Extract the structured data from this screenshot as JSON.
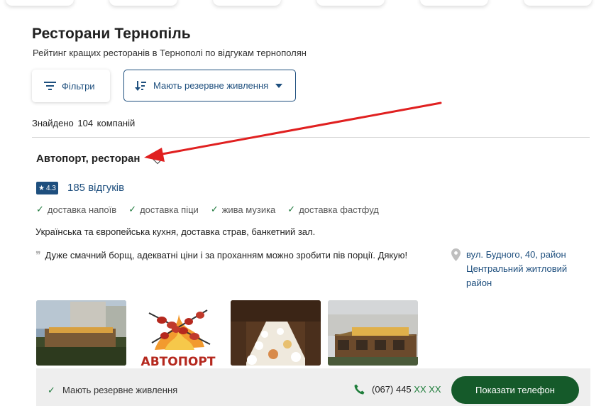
{
  "header": {
    "title": "Ресторани Тернопіль",
    "subtitle": "Рейтинг кращих ресторанів в Тернополі по відгукам тернополян"
  },
  "toolbar": {
    "filters_label": "Фільтри",
    "sort_value": "Мають резервне живлення"
  },
  "results": {
    "found_text": "Знайдено  104  компаній"
  },
  "company": {
    "name": "Автопорт, ресторан",
    "rating": "4.3",
    "reviews": "185 відгуків",
    "features": [
      "доставка напоїв",
      "доставка піци",
      "жива музика",
      "доставка фастфуд"
    ],
    "description": "Українська та європейська кухня, доставка страв, банкетний зал.",
    "review": "Дуже смачний борщ, адекватні ціни і за проханням можно зробити пів порції. Дякую!",
    "address": "вул. Будного, 40, район Центральний житловий район",
    "photo_sign_text": "АВТОПОРТ",
    "footer": {
      "feature": "Мають резервне живлення",
      "phone_visible": "(067) 445",
      "phone_masked": "ХХ ХХ",
      "button": "Показати телефон"
    }
  },
  "icons": [
    "filter-icon",
    "sort-icon",
    "caret-down-icon",
    "heart-icon",
    "star-icon",
    "check-icon",
    "quote-icon",
    "location-pin-icon",
    "phone-icon",
    "arrow-annotation"
  ],
  "colors": {
    "accent_blue": "#1e4f7e",
    "check_green": "#1f7a3d",
    "button_green": "#155a2a",
    "annotation_red": "#e02020"
  }
}
